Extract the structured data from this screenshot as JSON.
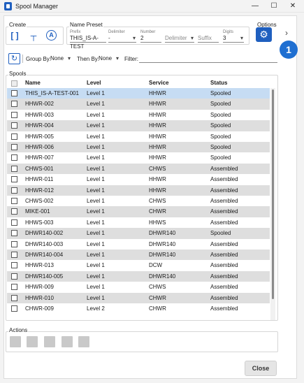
{
  "window": {
    "title": "Spool Manager",
    "min": "—",
    "max": "☐",
    "close": "✕"
  },
  "create": {
    "label": "Create"
  },
  "name_preset": {
    "label": "Name Preset",
    "prefix_label": "Prefix",
    "prefix_value": "THIS_IS-A-TEST",
    "delim1_label": "Delimiter",
    "delim1_value": "-",
    "number_label": "Number",
    "number_value": "2",
    "delim2_value": "Delimiter",
    "suffix_value": "Suffix",
    "digits_label": "Digits",
    "digits_value": "3"
  },
  "options": {
    "label": "Options"
  },
  "badge": "1",
  "toolbar": {
    "group_by_label": "Group By:",
    "group_by_value": "None",
    "then_by_label": "Then By:",
    "then_by_value": "None",
    "filter_label": "Filter:"
  },
  "spools": {
    "label": "Spools",
    "headers": [
      "Name",
      "Level",
      "Service",
      "Status"
    ],
    "rows": [
      [
        "THIS_IS-A-TEST-001",
        "Level 1",
        "HHWR",
        "Spooled"
      ],
      [
        "HHWR-002",
        "Level 1",
        "HHWR",
        "Spooled"
      ],
      [
        "HHWR-003",
        "Level 1",
        "HHWR",
        "Spooled"
      ],
      [
        "HHWR-004",
        "Level 1",
        "HHWR",
        "Spooled"
      ],
      [
        "HHWR-005",
        "Level 1",
        "HHWR",
        "Spooled"
      ],
      [
        "HHWR-006",
        "Level 1",
        "HHWR",
        "Spooled"
      ],
      [
        "HHWR-007",
        "Level 1",
        "HHWR",
        "Spooled"
      ],
      [
        "CHWS-001",
        "Level 1",
        "CHWS",
        "Assembled"
      ],
      [
        "HHWR-011",
        "Level 1",
        "HHWR",
        "Assembled"
      ],
      [
        "HHWR-012",
        "Level 1",
        "HHWR",
        "Assembled"
      ],
      [
        "CHWS-002",
        "Level 1",
        "CHWS",
        "Assembled"
      ],
      [
        "MIKE-001",
        "Level 1",
        "CHWR",
        "Assembled"
      ],
      [
        "HHWS-003",
        "Level 1",
        "HHWS",
        "Assembled"
      ],
      [
        "DHWR140-002",
        "Level 1",
        "DHWR140",
        "Spooled"
      ],
      [
        "DHWR140-003",
        "Level 1",
        "DHWR140",
        "Assembled"
      ],
      [
        "DHWR140-004",
        "Level 1",
        "DHWR140",
        "Assembled"
      ],
      [
        "HHWR-013",
        "Level 1",
        "DCW",
        "Assembled"
      ],
      [
        "DHWR140-005",
        "Level 1",
        "DHWR140",
        "Assembled"
      ],
      [
        "HHWR-009",
        "Level 1",
        "CHWS",
        "Assembled"
      ],
      [
        "HHWR-010",
        "Level 1",
        "CHWR",
        "Assembled"
      ],
      [
        "CHWR-009",
        "Level 2",
        "CHWR",
        "Assembled"
      ]
    ]
  },
  "actions": {
    "label": "Actions"
  },
  "close_label": "Close"
}
